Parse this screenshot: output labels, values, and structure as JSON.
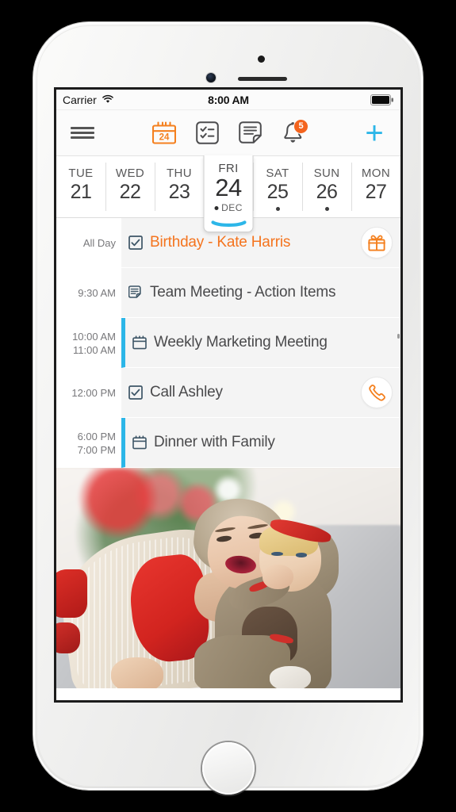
{
  "status_bar": {
    "carrier": "Carrier",
    "wifi_icon": "wifi-icon",
    "time": "8:00 AM",
    "battery_icon": "battery-full-icon"
  },
  "toolbar": {
    "menu_icon": "hamburger-menu-icon",
    "items": [
      {
        "icon": "calendar-icon",
        "label": "24",
        "active": true
      },
      {
        "icon": "checklist-icon",
        "label": "",
        "active": false
      },
      {
        "icon": "notes-icon",
        "label": "",
        "active": false
      },
      {
        "icon": "bell-icon",
        "label": "",
        "active": false,
        "badge": "5"
      }
    ],
    "add_label": "+",
    "accent_orange": "#f4741e",
    "accent_blue": "#2cb6e8",
    "badge_color": "#f4641e"
  },
  "day_strip": {
    "days": [
      {
        "name": "TUE",
        "number": "21",
        "has_dot": false,
        "selected": false
      },
      {
        "name": "WED",
        "number": "22",
        "has_dot": false,
        "selected": false
      },
      {
        "name": "THU",
        "number": "23",
        "has_dot": false,
        "selected": false
      },
      {
        "name": "FRI",
        "number": "24",
        "month": "DEC",
        "has_dot": true,
        "selected": true
      },
      {
        "name": "SAT",
        "number": "25",
        "has_dot": true,
        "selected": false
      },
      {
        "name": "SUN",
        "number": "26",
        "has_dot": true,
        "selected": false
      },
      {
        "name": "MON",
        "number": "27",
        "has_dot": false,
        "selected": false
      }
    ],
    "selected_underline_color": "#2cb6e8"
  },
  "events": [
    {
      "time_start": "All Day",
      "time_end": "",
      "type_icon": "checkbox-checked-icon",
      "title": "Birthday - Kate Harris",
      "highlight": true,
      "bar": false,
      "action_icon": "gift-icon"
    },
    {
      "time_start": "9:30 AM",
      "time_end": "",
      "type_icon": "note-icon",
      "title": "Team Meeting - Action Items",
      "highlight": false,
      "bar": false,
      "action_icon": ""
    },
    {
      "time_start": "10:00 AM",
      "time_end": "11:00 AM",
      "type_icon": "calendar-event-icon",
      "title": "Weekly Marketing Meeting",
      "highlight": false,
      "bar": true,
      "action_icon": ""
    },
    {
      "time_start": "12:00 PM",
      "time_end": "",
      "type_icon": "checkbox-checked-icon",
      "title": "Call Ashley",
      "highlight": false,
      "bar": false,
      "action_icon": "phone-icon"
    },
    {
      "time_start": "6:00 PM",
      "time_end": "7:00 PM",
      "type_icon": "calendar-event-icon",
      "title": "Dinner with Family",
      "highlight": false,
      "bar": true,
      "action_icon": ""
    }
  ],
  "photo": {
    "name": "event-photo-mother-and-child-christmas"
  },
  "device": {
    "home_button": "home-button",
    "front_camera": "front-camera",
    "earpiece": "earpiece-speaker"
  }
}
